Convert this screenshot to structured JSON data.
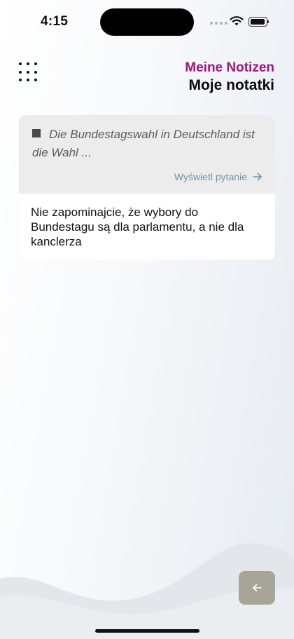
{
  "status": {
    "time": "4:15"
  },
  "header": {
    "title_de": "Meine Notizen",
    "title_pl": "Moje notatki"
  },
  "note": {
    "question": "Die Bundestagswahl in Deutschland ist die Wahl ...",
    "view_question_label": "Wyświetl pytanie",
    "text": "Nie zapominajcie, że wybory do Bundestagu są dla parlamentu, a nie dla kanclerza"
  },
  "colors": {
    "accent": "#a0157f",
    "link": "#6e93a8",
    "back_button": "#a7a498"
  },
  "icons": {
    "menu": "grid-dots-icon",
    "back": "arrow-left-icon",
    "link_arrow": "arrow-right-icon"
  }
}
